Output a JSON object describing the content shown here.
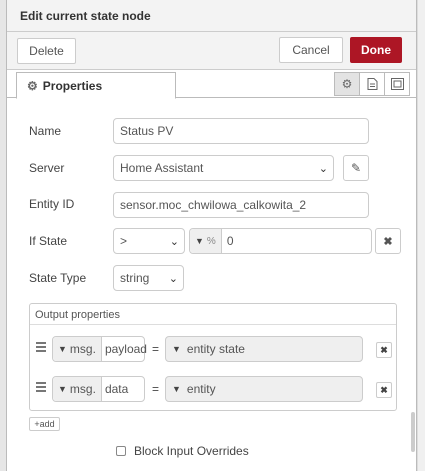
{
  "tray": {
    "title": "Edit current state node",
    "delete_label": "Delete",
    "cancel_label": "Cancel",
    "done_label": "Done"
  },
  "tabs": {
    "properties_label": "Properties",
    "icons": [
      "gear-icon",
      "description-icon",
      "appearance-icon"
    ]
  },
  "form": {
    "name_label": "Name",
    "name_value": "Status PV",
    "server_label": "Server",
    "server_value": "Home Assistant",
    "entity_label": "Entity ID",
    "entity_value": "sensor.moc_chwilowa_calkowita_2",
    "ifstate_label": "If State",
    "ifstate_op": ">",
    "ifstate_type": "%",
    "ifstate_value": "0",
    "statetype_label": "State Type",
    "statetype_value": "string"
  },
  "output": {
    "title": "Output properties",
    "rows": [
      {
        "prefix": "msg.",
        "key": "payload",
        "eq": "=",
        "value": "entity state"
      },
      {
        "prefix": "msg.",
        "key": "data",
        "eq": "=",
        "value": "entity"
      }
    ],
    "add_label": "add"
  },
  "block_input": {
    "label": "Block Input Overrides",
    "checked": false
  },
  "colors": {
    "done": "#ad1625",
    "header_bg": "#f3f3f3"
  }
}
